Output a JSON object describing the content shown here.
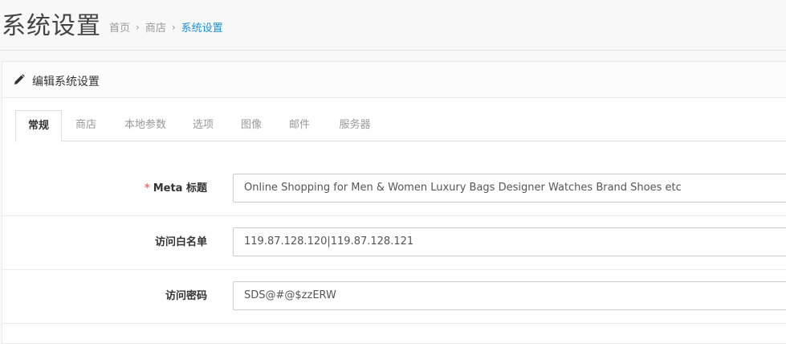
{
  "header": {
    "title": "系统设置",
    "breadcrumb": [
      {
        "label": "首页"
      },
      {
        "label": "商店"
      },
      {
        "label": "系统设置"
      }
    ],
    "separator": "›"
  },
  "panel": {
    "icon": "pencil-icon",
    "title": "编辑系统设置"
  },
  "tabs": [
    {
      "label": "常规",
      "active": true
    },
    {
      "label": "商店"
    },
    {
      "label": "本地参数"
    },
    {
      "label": "选项"
    },
    {
      "label": "图像"
    },
    {
      "label": "邮件"
    },
    {
      "label": "服务器"
    }
  ],
  "form": {
    "required_marker": "*",
    "fields": [
      {
        "label": "Meta 标题",
        "required": true,
        "value": "Online Shopping for Men & Women Luxury Bags Designer Watches Brand Shoes etc"
      },
      {
        "label": "访问白名单",
        "required": false,
        "value": "119.87.128.120|119.87.128.121"
      },
      {
        "label": "访问密码",
        "required": false,
        "value": "SDS@#@$zzERW"
      }
    ]
  },
  "colors": {
    "accent": "#1e91cf",
    "required": "#f56b6b"
  }
}
